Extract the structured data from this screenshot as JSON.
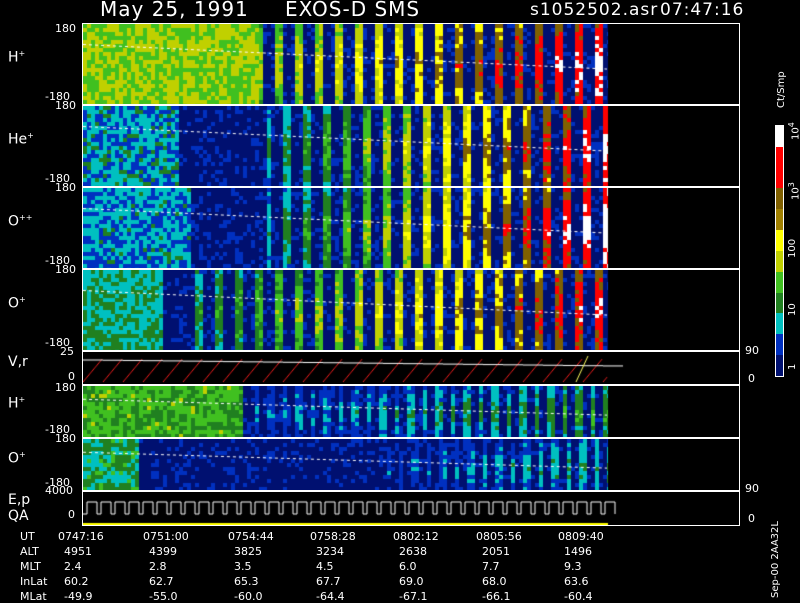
{
  "header": {
    "date": "May 25, 1991",
    "mission": "EXOS-D SMS",
    "file": "s1052502.asr",
    "time": "07:47:16"
  },
  "panels": [
    {
      "label": "H",
      "sup": "+",
      "ymax": "180",
      "ymin": "-180"
    },
    {
      "label": "He",
      "sup": "+",
      "ymax": "180",
      "ymin": "-180"
    },
    {
      "label": "O",
      "sup": "++",
      "ymax": "180",
      "ymin": "-180"
    },
    {
      "label": "O",
      "sup": "+",
      "ymax": "180",
      "ymin": "-180"
    },
    {
      "label": "V,r",
      "sup": "",
      "ymax": "25",
      "ymin": "0",
      "right_top": "90",
      "right_bottom": "0"
    },
    {
      "label": "H",
      "sup": "+",
      "ymax": "180",
      "ymin": "-180"
    },
    {
      "label": "O",
      "sup": "+",
      "ymax": "180",
      "ymin": "-180"
    },
    {
      "label": "E,p",
      "label2": "QA",
      "ymax": "4000",
      "ymin": "0",
      "right_top": "90",
      "right_bottom": "0"
    }
  ],
  "colorbar": {
    "title": "Ct/Smp",
    "ticks": [
      "10",
      "4",
      "10",
      "3",
      "100",
      "10",
      "1"
    ]
  },
  "table": {
    "row_labels": [
      "UT",
      "ALT",
      "MLT",
      "InLat",
      "MLat"
    ],
    "columns": [
      [
        "0747:16",
        "4951",
        "2.4",
        "60.2",
        "-49.9"
      ],
      [
        "0751:00",
        "4399",
        "2.8",
        "62.7",
        "-55.0"
      ],
      [
        "0754:44",
        "3825",
        "3.5",
        "65.3",
        "-60.0"
      ],
      [
        "0758:28",
        "3234",
        "4.5",
        "67.7",
        "-64.4"
      ],
      [
        "0802:12",
        "2638",
        "6.0",
        "69.0",
        "-67.1"
      ],
      [
        "0805:56",
        "2051",
        "7.7",
        "68.0",
        "-66.1"
      ],
      [
        "0809:40",
        "1496",
        "9.3",
        "63.6",
        "-60.4"
      ]
    ]
  },
  "footer_note": "Sep-00 2AA32L",
  "chart_data": {
    "type": "heatmap",
    "x_ticks": [
      "0747:16",
      "0751:00",
      "0754:44",
      "0758:28",
      "0802:12",
      "0805:56",
      "0809:40"
    ],
    "y_range_angle": [
      -180,
      180
    ],
    "colorbar_range": [
      1,
      10000
    ],
    "colorbar_scale": "log",
    "colors": [
      "#001070",
      "#0030c0",
      "#00c0c0",
      "#208020",
      "#40c020",
      "#c0d000",
      "#ffff00",
      "#806000",
      "#ff0000",
      "#ffffff"
    ]
  }
}
